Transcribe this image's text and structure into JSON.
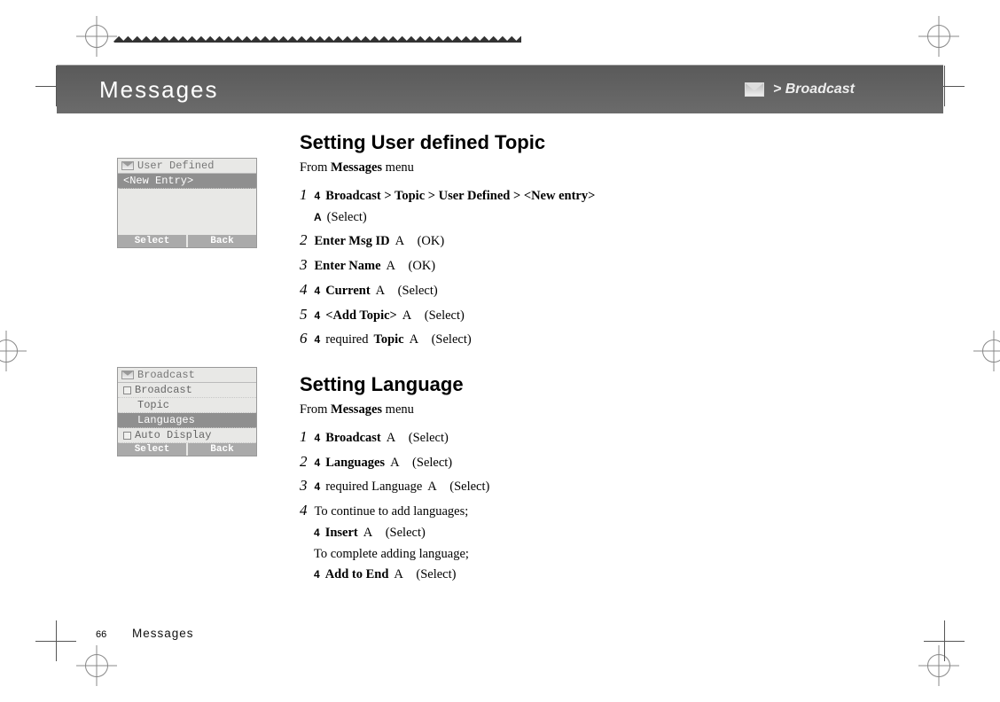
{
  "header": {
    "title": "Messages",
    "breadcrumb_icon": "envelope-icon",
    "breadcrumb": "> Broadcast"
  },
  "section_a": {
    "heading": "Setting User defined Topic",
    "from_prefix": "From ",
    "from_bold": "Messages",
    "from_suffix": " menu",
    "steps": [
      {
        "n": "1",
        "pre": "4",
        "bold": "Broadcast > Topic > User Defined > <New entry>",
        "post": ""
      },
      {
        "n": "",
        "pre": "A",
        "bold": "",
        "post": "(Select)",
        "indent": true
      },
      {
        "n": "2",
        "pre": "",
        "bold": "Enter Msg ID",
        "post": "A (OK)"
      },
      {
        "n": "3",
        "pre": "",
        "bold": "Enter Name",
        "post": "A (OK)"
      },
      {
        "n": "4",
        "pre": "4",
        "bold": "Current",
        "post": "A (Select)"
      },
      {
        "n": "5",
        "pre": "4",
        "bold": "<Add Topic>",
        "post": "A (Select)"
      },
      {
        "n": "6",
        "pre": "4",
        "plain": "required ",
        "bold": "Topic",
        "post": "A (Select)"
      }
    ]
  },
  "section_b": {
    "heading": "Setting Language",
    "from_prefix": "From ",
    "from_bold": "Messages",
    "from_suffix": " menu",
    "steps": [
      {
        "n": "1",
        "pre": "4",
        "bold": "Broadcast",
        "post": "A (Select)"
      },
      {
        "n": "2",
        "pre": "4",
        "bold": "Languages",
        "post": "A (Select)"
      },
      {
        "n": "3",
        "pre": "4",
        "plain": "required Language",
        "post": "A (Select)"
      },
      {
        "n": "4",
        "pre": "",
        "plain": "To continue to add languages;",
        "post": ""
      },
      {
        "n": "",
        "pre": "4",
        "bold": "Insert",
        "post": "A (Select)",
        "indent": true
      },
      {
        "n": "",
        "pre": "",
        "plain": "To complete adding language;",
        "post": "",
        "indent": true
      },
      {
        "n": "",
        "pre": "4",
        "bold": "Add to End",
        "post": "A (Select)",
        "indent": true
      }
    ]
  },
  "lcd1": {
    "title": "User Defined",
    "rows": [
      {
        "label": "<New Entry>",
        "selected": true
      }
    ],
    "softkeys": {
      "left": "Select",
      "right": "Back"
    }
  },
  "lcd2": {
    "title": "Broadcast",
    "rows": [
      {
        "label": "Broadcast",
        "checkbox": true
      },
      {
        "label": "Topic",
        "sub": true
      },
      {
        "label": "Languages",
        "selected": true,
        "sub": true
      },
      {
        "label": "Auto Display",
        "checkbox": true
      }
    ],
    "softkeys": {
      "left": "Select",
      "right": "Back"
    }
  },
  "footer": {
    "page": "66",
    "section": "Messages"
  },
  "decor": {
    "dotrow": "◆◆◆◆◆◆◆◆◆◆◆◆◆◆◆◆◆◆◆◆◆◆◆◆◆◆◆◆◆◆◆◆◆◆◆◆◆◆◆◆◆◆◆◆◆◆◆◆◆◆◆◆◆◆◆◆◆◆"
  }
}
